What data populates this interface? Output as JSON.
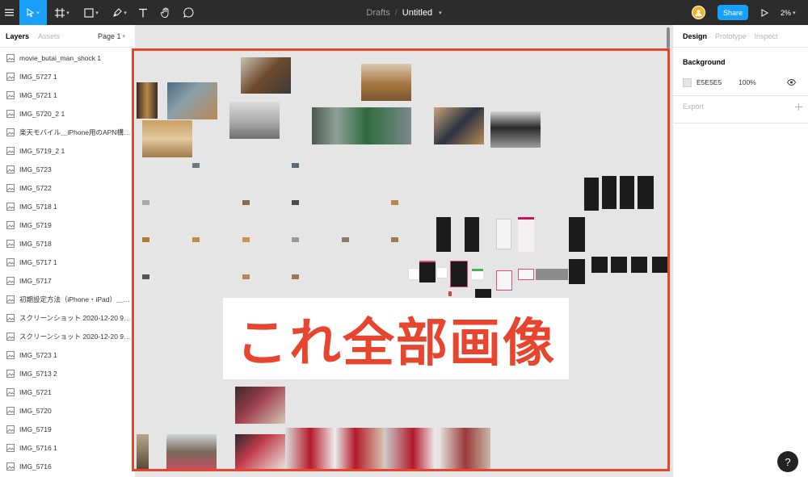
{
  "toolbar": {
    "breadcrumb_project": "Drafts",
    "breadcrumb_sep": "/",
    "file_name": "Untitled",
    "share_label": "Share",
    "zoom_label": "2%"
  },
  "left_panel": {
    "tab_layers": "Layers",
    "tab_assets": "Assets",
    "page_selector": "Page 1",
    "layers": [
      "movie_butai_man_shock 1",
      "IMG_5727 1",
      "IMG_5721 1",
      "IMG_5720_2 1",
      "楽天モバイル＿iPhone用のAPN構成...",
      "IMG_5719_2 1",
      "IMG_5723",
      "IMG_5722",
      "IMG_5718 1",
      "IMG_5719",
      "IMG_5718",
      "IMG_5717 1",
      "IMG_5717",
      "初期設定方法（iPhone・iPad）＿＿...",
      "スクリーンショット 2020-12-20 9.52...",
      "スクリーンショット 2020-12-20 9.39...",
      "IMG_5723 1",
      "IMG_5713 2",
      "IMG_5721",
      "IMG_5720",
      "IMG_5719",
      "IMG_5716 1",
      "IMG_5716"
    ]
  },
  "canvas": {
    "background": "#E5E5E5",
    "outline_color": "#E8452F",
    "banner_text": "これ全部画像"
  },
  "right_panel": {
    "tab_design": "Design",
    "tab_prototype": "Prototype",
    "tab_inspect": "Inspect",
    "background_title": "Background",
    "bg_hex": "E5E5E5",
    "bg_opacity": "100%",
    "export_title": "Export"
  },
  "help_label": "?"
}
